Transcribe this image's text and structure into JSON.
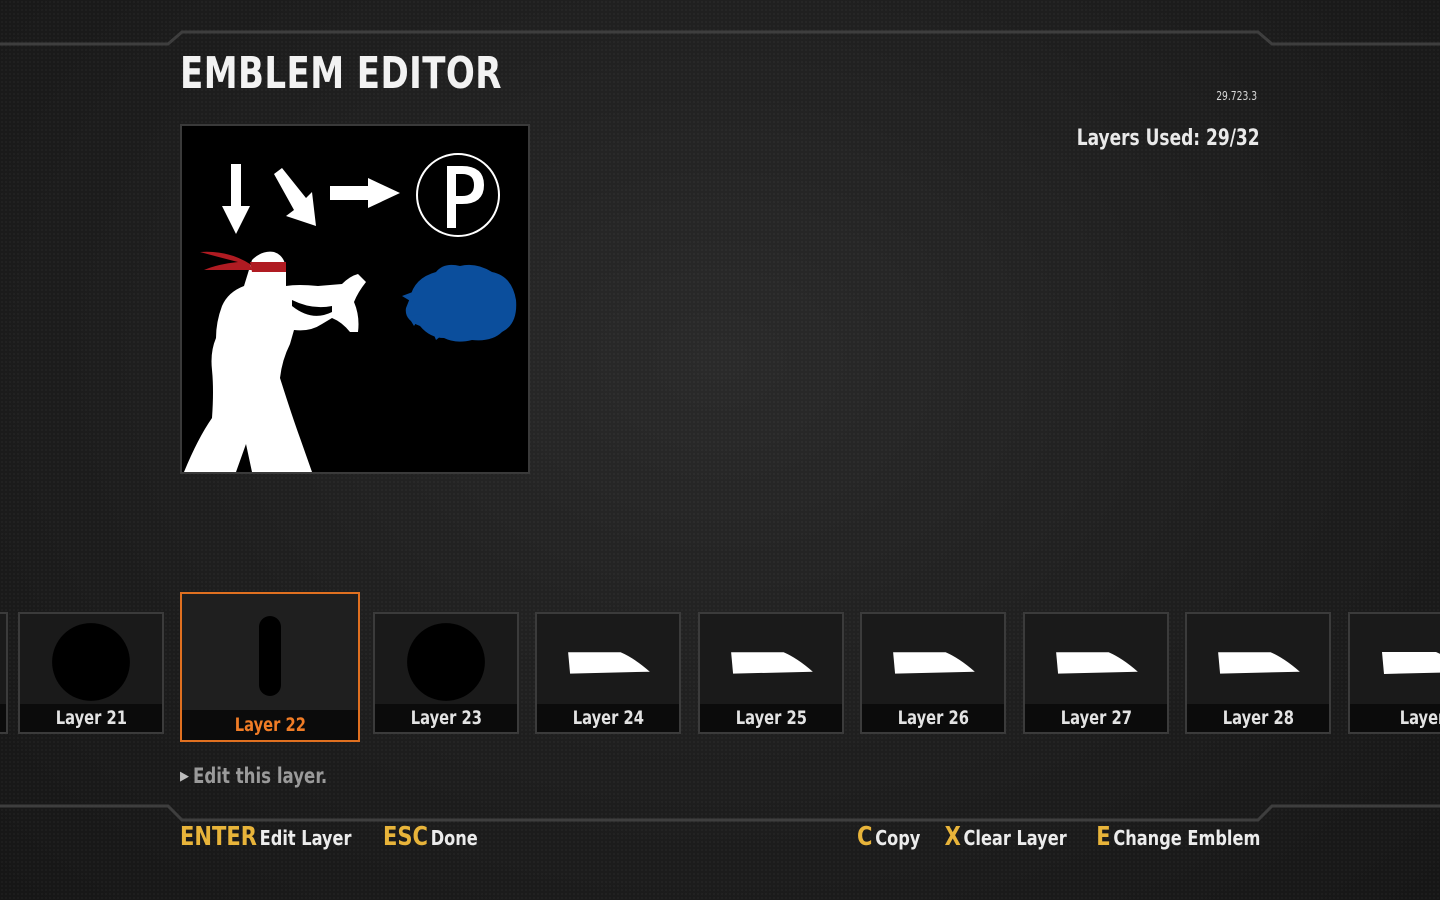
{
  "header": {
    "title": "EMBLEM EDITOR",
    "version": "29.723.3",
    "layers_used": "Layers Used: 29/32"
  },
  "emblem": {
    "description_icons": [
      "down-arrow",
      "diagonal-arrow",
      "right-arrow",
      "p-button",
      "fighter-silhouette",
      "red-headband",
      "blue-fireball"
    ],
    "colors": {
      "background": "#000000",
      "figure": "#ffffff",
      "headband": "#b01b22",
      "fireball": "#0b4e9c"
    }
  },
  "layers": [
    {
      "label": "Layer 21",
      "shape": "circle"
    },
    {
      "label": "Layer 22",
      "shape": "capsule",
      "selected": true
    },
    {
      "label": "Layer 23",
      "shape": "circle"
    },
    {
      "label": "Layer 24",
      "shape": "blade"
    },
    {
      "label": "Layer 25",
      "shape": "blade"
    },
    {
      "label": "Layer 26",
      "shape": "blade"
    },
    {
      "label": "Layer 27",
      "shape": "blade"
    },
    {
      "label": "Layer 28",
      "shape": "blade"
    },
    {
      "label": "Layer",
      "shape": "blade"
    }
  ],
  "hint": {
    "text": "Edit this layer."
  },
  "footer": {
    "left": [
      {
        "key": "ENTER",
        "action": "Edit Layer"
      },
      {
        "key": "ESC",
        "action": "Done"
      }
    ],
    "right": [
      {
        "key": "C",
        "action": "Copy"
      },
      {
        "key": "X",
        "action": "Clear Layer"
      },
      {
        "key": "E",
        "action": "Change Emblem"
      }
    ]
  },
  "colors": {
    "accent_selected": "#e07020",
    "key_gold": "#e8b43a"
  }
}
